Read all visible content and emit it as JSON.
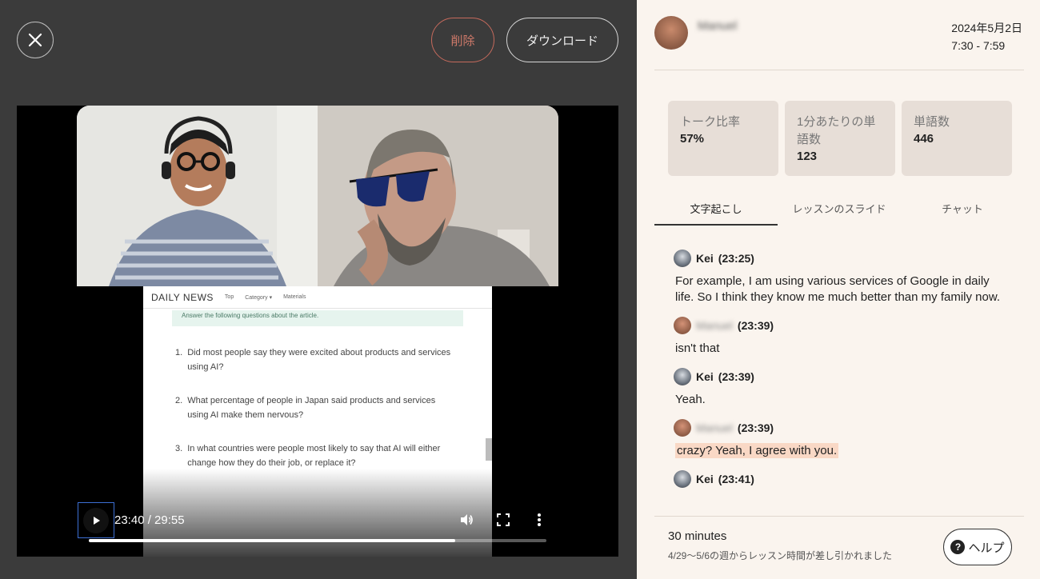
{
  "toolbar": {
    "delete_label": "削除",
    "download_label": "ダウンロード"
  },
  "video": {
    "slide": {
      "logo": "DAILY NEWS",
      "nav": [
        "Top",
        "Category ▾",
        "Materials"
      ],
      "instruction": "Answer the following questions about the article.",
      "questions": [
        {
          "num": "1.",
          "text": "Did most people say they were excited about products and services using AI?"
        },
        {
          "num": "2.",
          "text": "What percentage of people in Japan said products and services using AI make them nervous?"
        },
        {
          "num": "3.",
          "text": "In what countries were people most likely to say that AI will either change how they do their job, or replace it?"
        }
      ]
    },
    "time": "23:40 / 29:55",
    "progress": 0.8
  },
  "header": {
    "user_name": "Manuel",
    "date": "2024年5月2日",
    "time_range": "7:30 - 7:59"
  },
  "stats": [
    {
      "label": "トーク比率",
      "value": "57%"
    },
    {
      "label": "1分あたりの単語数",
      "value": "123"
    },
    {
      "label": "単語数",
      "value": "446"
    }
  ],
  "tabs": [
    "文字起こし",
    "レッスンのスライド",
    "チャット"
  ],
  "transcript": [
    {
      "speaker": "Kei",
      "time": "(23:25)",
      "text": "For example, I am using various services of Google in daily life. So I think they know me much better than my family now.",
      "highlight": false
    },
    {
      "speaker": "Manuel",
      "time": "(23:39)",
      "text": "isn't that",
      "highlight": false
    },
    {
      "speaker": "Kei",
      "time": "(23:39)",
      "text": "Yeah.",
      "highlight": false
    },
    {
      "speaker": "Manuel",
      "time": "(23:39)",
      "text": "crazy? Yeah, I agree with you.",
      "highlight": true
    },
    {
      "speaker": "Kei",
      "time": "(23:41)",
      "text": "",
      "highlight": false
    }
  ],
  "footer": {
    "minutes": "30 minutes",
    "note": "4/29〜5/6の週からレッスン時間が差し引かれました",
    "help_label": "ヘルプ"
  }
}
